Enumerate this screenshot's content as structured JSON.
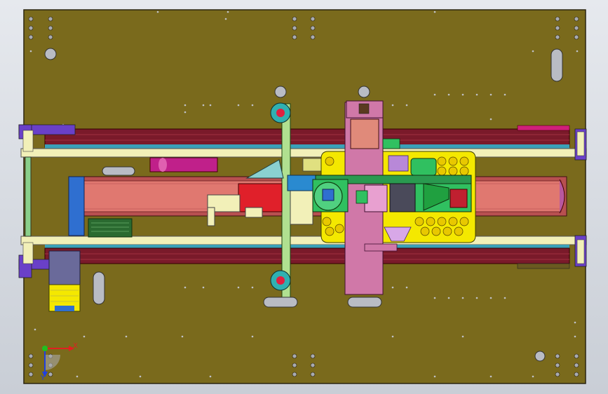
{
  "view": {
    "background_top": "#e6e9ee",
    "background_bottom": "#c9ced6"
  },
  "colors": {
    "base_plate": "#7a6a1c",
    "base_outline": "#2a2410",
    "rail_dark_red": "#7a1a2a",
    "rail_light": "#f2f0b8",
    "belt_salmon": "#e07870",
    "carriage_yellow": "#f4e800",
    "carriage_pink": "#d078a8",
    "guide_green": "#b0e090",
    "motor_blue": "#2f6fd0",
    "accent_magenta": "#c0208a",
    "accent_red": "#e0202a",
    "accent_cyan": "#30b0b0",
    "accent_purple": "#6a40c8",
    "hole_gray": "#a8aab0"
  },
  "triad": {
    "x_label": "X",
    "y_label": "Y",
    "x_color": "#e02020",
    "y_color": "#2040e0",
    "origin_color": "#20c020"
  }
}
